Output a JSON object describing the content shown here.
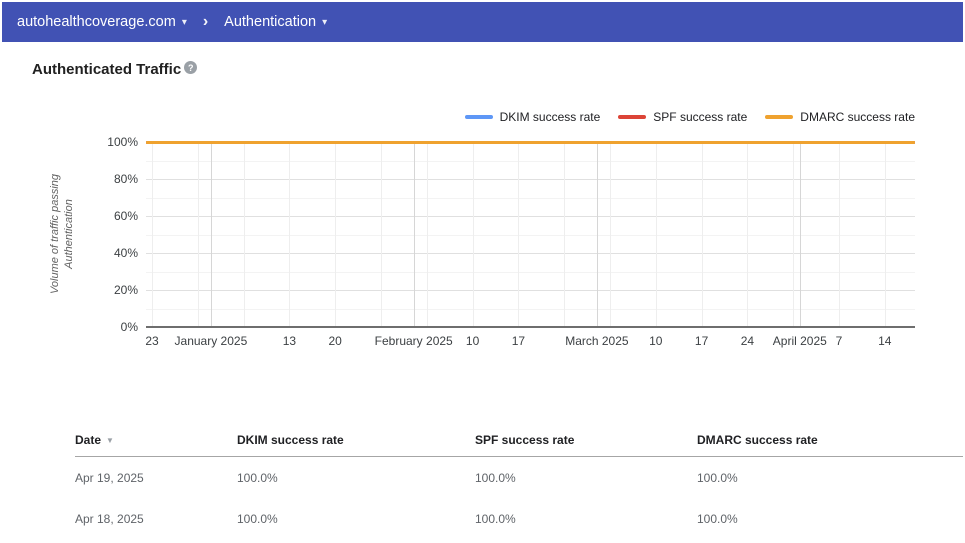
{
  "header": {
    "domain": "autohealthcoverage.com",
    "separator": "›",
    "section": "Authentication",
    "dropdown_caret": "▾"
  },
  "page": {
    "title": "Authenticated Traffic",
    "help_icon": "?"
  },
  "chart_data": {
    "type": "line",
    "title": "Authenticated Traffic",
    "ylabel": "Volume of traffic passing Authentication",
    "ylabel_lines": [
      "Volume of traffic passing",
      "Authentication"
    ],
    "ylim": [
      0,
      100
    ],
    "y_tick_labels": [
      "0%",
      "20%",
      "40%",
      "60%",
      "80%",
      "100%"
    ],
    "grid": true,
    "legend_position": "top-right",
    "x_range": [
      "Dec 23, 2024",
      "Apr 19, 2025"
    ],
    "x_ticks": [
      {
        "label": "23",
        "day": 0
      },
      {
        "label": "January 2025",
        "day": 9
      },
      {
        "label": "13",
        "day": 21
      },
      {
        "label": "20",
        "day": 28
      },
      {
        "label": "February 2025",
        "day": 40
      },
      {
        "label": "10",
        "day": 49
      },
      {
        "label": "17",
        "day": 56
      },
      {
        "label": "March 2025",
        "day": 68
      },
      {
        "label": "10",
        "day": 77
      },
      {
        "label": "17",
        "day": 84
      },
      {
        "label": "24",
        "day": 91
      },
      {
        "label": "April 2025",
        "day": 99
      },
      {
        "label": "7",
        "day": 105
      },
      {
        "label": "14",
        "day": 112
      }
    ],
    "week_gridline_days": [
      0,
      7,
      14,
      21,
      28,
      35,
      42,
      49,
      56,
      63,
      70,
      77,
      84,
      91,
      98,
      105,
      112
    ],
    "month_gridline_days": [
      9,
      40,
      68,
      99
    ],
    "series": [
      {
        "name": "DKIM success rate",
        "color": "#5e97f6",
        "constant_value_percent": 100
      },
      {
        "name": "SPF success rate",
        "color": "#dc4437",
        "constant_value_percent": 100
      },
      {
        "name": "DMARC success rate",
        "color": "#efa22f",
        "constant_value_percent": 100
      }
    ]
  },
  "table": {
    "columns": [
      {
        "label": "Date",
        "sortable": true,
        "sort_icon": "▼"
      },
      {
        "label": "DKIM success rate"
      },
      {
        "label": "SPF success rate"
      },
      {
        "label": "DMARC success rate"
      }
    ],
    "rows": [
      [
        "Apr 19, 2025",
        "100.0%",
        "100.0%",
        "100.0%"
      ],
      [
        "Apr 18, 2025",
        "100.0%",
        "100.0%",
        "100.0%"
      ]
    ]
  },
  "colors": {
    "topbar": "#4152b4",
    "dkim": "#5e97f6",
    "spf": "#dc4437",
    "dmarc": "#efa22f"
  }
}
